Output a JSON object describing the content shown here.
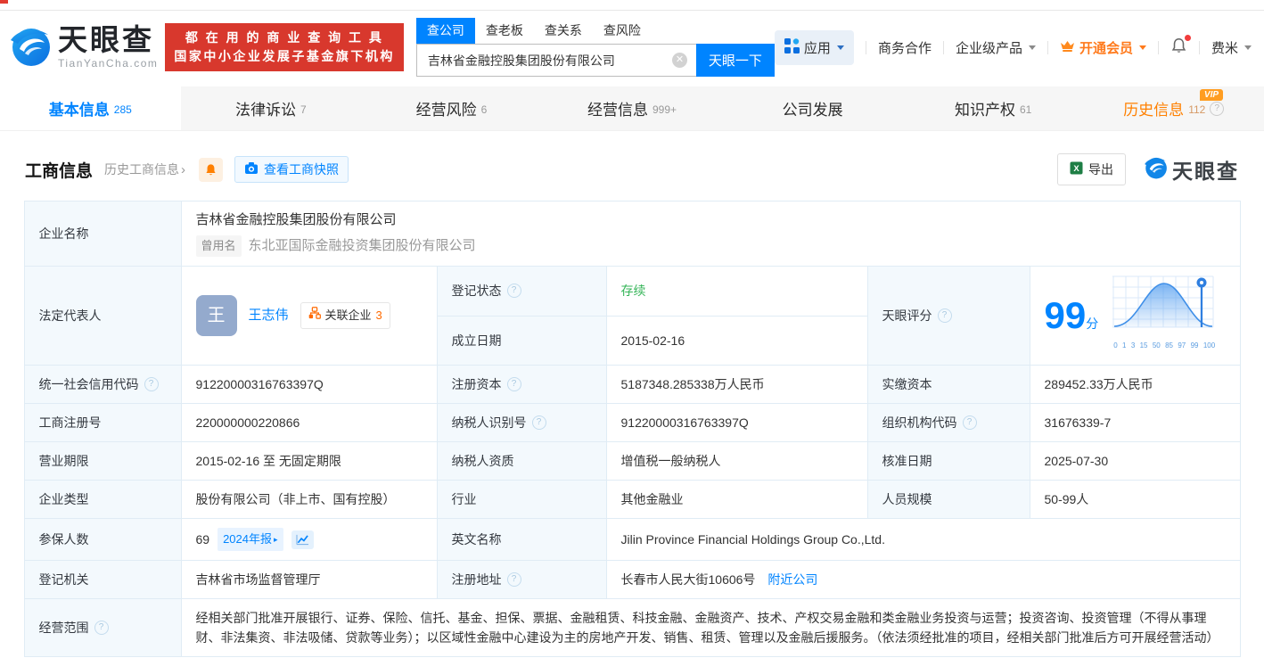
{
  "header": {
    "brand": {
      "name": "天眼查",
      "domain": "TianYanCha.com"
    },
    "slogan": {
      "line1": "都 在 用 的 商 业 查 询 工 具",
      "line2": "国家中小企业发展子基金旗下机构"
    },
    "search": {
      "tabs": [
        {
          "label": "查公司"
        },
        {
          "label": "查老板"
        },
        {
          "label": "查关系"
        },
        {
          "label": "查风险"
        }
      ],
      "input_value": "吉林省金融控股集团股份有限公司",
      "button_label": "天眼一下"
    },
    "nav": {
      "apps": "应用",
      "cooperation": "商务合作",
      "enterprise": "企业级产品",
      "vip": "开通会员",
      "user": "费米"
    }
  },
  "tabbar": {
    "items": [
      {
        "label": "基本信息",
        "count": "285"
      },
      {
        "label": "法律诉讼",
        "count": "7"
      },
      {
        "label": "经营风险",
        "count": "6"
      },
      {
        "label": "经营信息",
        "count": "999+"
      },
      {
        "label": "公司发展",
        "count": ""
      },
      {
        "label": "知识产权",
        "count": "61"
      },
      {
        "label": "历史信息",
        "count": "112",
        "badge": "VIP"
      }
    ]
  },
  "section": {
    "title": "工商信息",
    "history_link": "历史工商信息",
    "snapshot_button": "查看工商快照",
    "export_button": "导出",
    "watermark": "天眼查"
  },
  "info": {
    "company_name_label": "企业名称",
    "company_name": "吉林省金融控股集团股份有限公司",
    "former_name_badge": "曾用名",
    "former_name": "东北亚国际金融投资集团股份有限公司",
    "legal_rep_label": "法定代表人",
    "legal_rep_avatar": "王",
    "legal_rep_name": "王志伟",
    "related_label": "关联企业",
    "related_count": "3",
    "reg_status_label": "登记状态",
    "reg_status": "存续",
    "establish_date_label": "成立日期",
    "establish_date": "2015-02-16",
    "score_label": "天眼评分",
    "score_value": "99",
    "score_unit": "分",
    "credit_code_label": "统一社会信用代码",
    "credit_code": "91220000316763397Q",
    "reg_capital_label": "注册资本",
    "reg_capital": "5187348.285338万人民币",
    "paid_capital_label": "实缴资本",
    "paid_capital": "289452.33万人民币",
    "reg_number_label": "工商注册号",
    "reg_number": "220000000220866",
    "taxpayer_id_label": "纳税人识别号",
    "taxpayer_id": "91220000316763397Q",
    "org_code_label": "组织机构代码",
    "org_code": "31676339-7",
    "business_term_label": "营业期限",
    "business_term": "2015-02-16 至 无固定期限",
    "taxpayer_quality_label": "纳税人资质",
    "taxpayer_quality": "增值税一般纳税人",
    "approval_date_label": "核准日期",
    "approval_date": "2025-07-30",
    "company_type_label": "企业类型",
    "company_type": "股份有限公司（非上市、国有控股）",
    "industry_label": "行业",
    "industry": "其他金融业",
    "staff_size_label": "人员规模",
    "staff_size": "50-99人",
    "insured_label": "参保人数",
    "insured_count": "69",
    "annual_report_badge": "2024年报",
    "english_name_label": "英文名称",
    "english_name": "Jilin Province Financial Holdings Group Co.,Ltd.",
    "reg_authority_label": "登记机关",
    "reg_authority": "吉林省市场监督管理厅",
    "address_label": "注册地址",
    "address": "长春市人民大街10606号",
    "nearby_link": "附近公司",
    "business_scope_label": "经营范围",
    "business_scope": "经相关部门批准开展银行、证券、保险、信托、基金、担保、票据、金融租赁、科技金融、金融资产、技术、产权交易金融和类金融业务投资与运营；投资咨询、投资管理（不得从事理财、非法集资、非法吸储、贷款等业务）；以区域性金融中心建设为主的房地产开发、销售、租赁、管理以及金融后援服务。（依法须经批准的项目，经相关部门批准后方可开展经营活动）"
  },
  "chart_data": {
    "type": "area",
    "title": "天眼评分 score distribution curve",
    "x_tick_labels": [
      "0",
      "1",
      "3",
      "15",
      "50",
      "85",
      "97",
      "99",
      "100"
    ],
    "score": 99,
    "marker_at": "99",
    "legend_position": "none",
    "grid": true
  },
  "colors": {
    "brand_blue": "#0084ff",
    "banner_red": "#d8382d",
    "vip_orange": "#ff8000",
    "status_green": "#35b558",
    "label_bg": "#f3f9fd",
    "table_border": "#e0ecf5"
  }
}
